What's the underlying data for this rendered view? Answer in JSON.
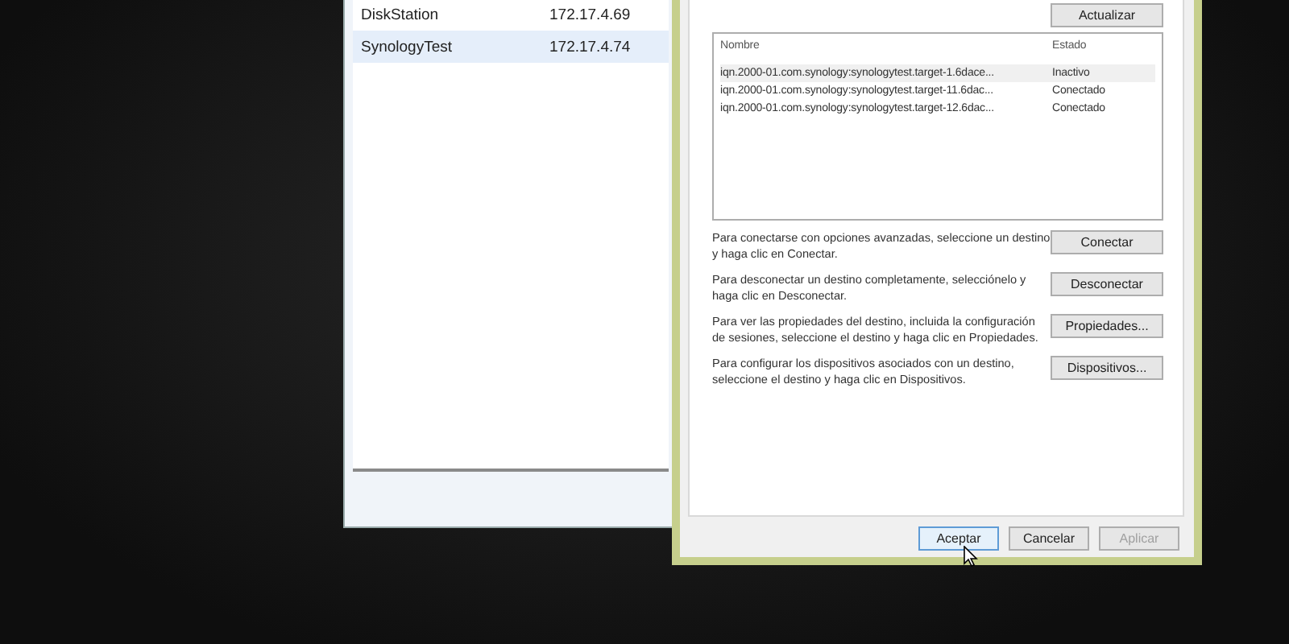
{
  "devices_window": {
    "rows": [
      {
        "name": "DiskStation",
        "address": "172.17.4.69",
        "selected": false
      },
      {
        "name": "SynologyTest",
        "address": "172.17.4.74",
        "selected": true
      }
    ]
  },
  "targets_dialog": {
    "refresh_button": "Actualizar",
    "targets": {
      "columns": [
        "Nombre",
        "Estado"
      ],
      "rows": [
        {
          "name": "iqn.2000-01.com.synology:synologytest.target-1.6dace...",
          "status": "Inactivo",
          "selected": true
        },
        {
          "name": "iqn.2000-01.com.synology:synologytest.target-11.6dac...",
          "status": "Conectado",
          "selected": false
        },
        {
          "name": "iqn.2000-01.com.synology:synologytest.target-12.6dac...",
          "status": "Conectado",
          "selected": false
        }
      ]
    },
    "actions": [
      {
        "text": "Para conectarse con opciones avanzadas, seleccione un destino y haga clic en Conectar.",
        "button": "Conectar"
      },
      {
        "text": "Para desconectar un destino completamente, selecciónelo y haga clic en Desconectar.",
        "button": "Desconectar"
      },
      {
        "text": "Para ver las propiedades del destino, incluida la configuración de sesiones, seleccione el destino y haga clic en Propiedades.",
        "button": "Propiedades..."
      },
      {
        "text": "Para configurar los dispositivos asociados con un destino, seleccione el destino y haga clic en Dispositivos.",
        "button": "Dispositivos..."
      }
    ],
    "footer_buttons": [
      {
        "label": "Aceptar",
        "kind": "default",
        "disabled": false
      },
      {
        "label": "Cancelar",
        "kind": "normal",
        "disabled": false
      },
      {
        "label": "Aplicar",
        "kind": "normal",
        "disabled": true
      }
    ]
  }
}
